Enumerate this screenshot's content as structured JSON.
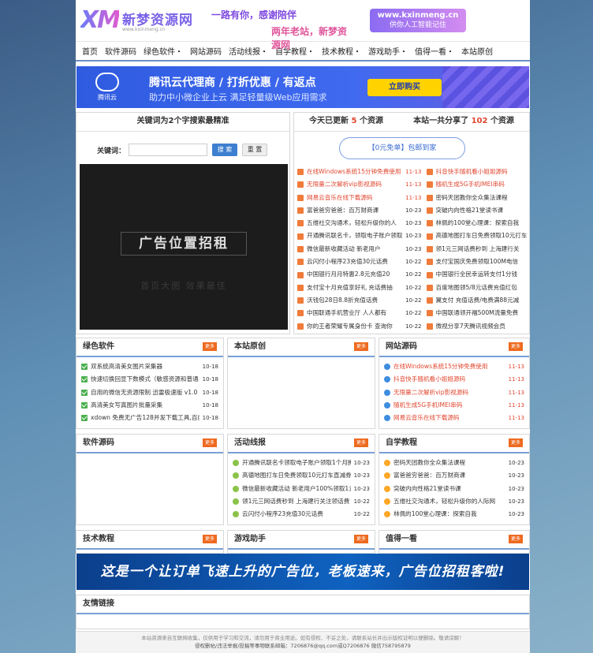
{
  "header": {
    "logo_mark": "XM",
    "logo_cn": "新梦资源网",
    "logo_en": "www.kxinmeng.cn",
    "slogan_line1": "一路有你，感谢陪伴",
    "slogan_line2": "两年老站，新梦资源网",
    "badge_url": "www.kxinmeng.cn",
    "badge_text": "供你人工智能记住"
  },
  "nav": {
    "items": [
      "首页",
      "软件源码",
      "绿色软件・",
      "网站源码",
      "活动线报・",
      "自学教程・",
      "技术教程・",
      "游戏助手・",
      "值得一看・",
      "本站原创"
    ]
  },
  "banner": {
    "brand": "腾讯云",
    "title": "腾讯云代理商 / 打折优惠 / 有返点",
    "subtitle": "助力中小微企业上云 满足轻量级Web应用需求",
    "button": "立即购买"
  },
  "search": {
    "heading": "关键词为2个字搜索最精准",
    "label": "关键词：",
    "button": "搜 索",
    "reset": "重 置",
    "ad_big": "广告位置招租",
    "ad_small": "首页大图 效果最佳"
  },
  "stats": {
    "today_prefix": "今天已更新",
    "today_count": "5",
    "today_suffix": "个资源",
    "total_prefix": "本站一共分享了",
    "total_count": "102",
    "total_suffix": "个资源",
    "free_button": "【0元免单】包邮到家"
  },
  "latest_left": [
    {
      "t": "在线Windows系统15分钟免费使用",
      "d": "11-13",
      "red": true
    },
    {
      "t": "无限量二次解析vip影视源码",
      "d": "11-13",
      "red": true
    },
    {
      "t": "网易云音乐在线下载源码",
      "d": "11-13",
      "red": true
    },
    {
      "t": "富爸爸穷爸爸：百万财商课",
      "d": "10-23",
      "red": false
    },
    {
      "t": "五维社交沟通术，轻松升级你的人",
      "d": "10-23",
      "red": false
    },
    {
      "t": "开通腾讯联名卡，领取电子账户领取",
      "d": "10-23",
      "red": false
    },
    {
      "t": "微信最新收藏活动 新老用户",
      "d": "10-23",
      "red": false
    },
    {
      "t": "云闪付小程序23充值30元话费",
      "d": "10-22",
      "red": false
    },
    {
      "t": "中国银行月月特惠2.8元充值20",
      "d": "10-22",
      "red": false
    },
    {
      "t": "支付宝十月充值享好礼 充话费抽",
      "d": "10-22",
      "red": false
    },
    {
      "t": "沃钱包28日8.8折充值话费",
      "d": "10-22",
      "red": false
    },
    {
      "t": "中国联通手机营业厅 人人都有",
      "d": "10-22",
      "red": false
    },
    {
      "t": "你的王者荣耀专属身份卡 查询你",
      "d": "10-22",
      "red": false
    }
  ],
  "latest_right": [
    {
      "t": "抖音快手随机看小姐姐源码",
      "d": "11-13",
      "red": true
    },
    {
      "t": "随机生成5G手机IMEI串码",
      "d": "11-13",
      "red": true
    },
    {
      "t": "密码天团教你全众集法课程",
      "d": "10-23",
      "red": false
    },
    {
      "t": "突破内向性格21堂读书课",
      "d": "10-23",
      "red": false
    },
    {
      "t": "林佩的100堂心理课：探索自我",
      "d": "10-23",
      "red": false
    },
    {
      "t": "高德地图打车日免费领取10元打车",
      "d": "10-23",
      "red": false
    },
    {
      "t": "领1元三网话费秒到 上海建行关",
      "d": "10-22",
      "red": false
    },
    {
      "t": "支付宝国庆免费领取100M电信",
      "d": "10-22",
      "red": false
    },
    {
      "t": "中国银行全民幸运转支付1分钱",
      "d": "10-22",
      "red": false
    },
    {
      "t": "百度地图领5/8元话费充值红包",
      "d": "10-22",
      "red": false
    },
    {
      "t": "翼支付 充值话费/电费满88元减",
      "d": "10-22",
      "red": false
    },
    {
      "t": "中国联通领开福500M流量免费",
      "d": "10-22",
      "red": false
    },
    {
      "t": "微视分享7天腾讯视频会员",
      "d": "10-22",
      "red": false
    }
  ],
  "sections": {
    "more": "更多",
    "green_software": {
      "title": "绿色软件",
      "items": [
        {
          "t": "双系统高清美女图片采集器",
          "d": "10-18"
        },
        {
          "t": "快速切换回显下数模式（敏感资源和普通",
          "d": "10-18"
        },
        {
          "t": "自用的微信无资源限制 迅雷极速版 v1.0",
          "d": "10-18"
        },
        {
          "t": "高清美女写真图片批量采集",
          "d": "10-18"
        },
        {
          "t": "xdown 免费无广告128并发下载工具,百度",
          "d": "10-18"
        }
      ]
    },
    "original": {
      "title": "本站原创",
      "items": []
    },
    "site_source": {
      "title": "网站源码",
      "items": [
        {
          "t": "在线Windows系统15分钟免费使用",
          "d": "11-13"
        },
        {
          "t": "抖音快手随机看小姐姐源码",
          "d": "11-13"
        },
        {
          "t": "无限量二次解析vip影视源码",
          "d": "11-13"
        },
        {
          "t": "随机生成5G手机IMEI串码",
          "d": "11-13"
        },
        {
          "t": "网易云音乐在线下载源码",
          "d": "11-13"
        }
      ]
    },
    "software_source": {
      "title": "软件源码",
      "items": []
    },
    "activity": {
      "title": "活动线报",
      "items": [
        {
          "t": "开通腾讯联名卡领取电子账户领取1个月腾讯",
          "d": "10-23"
        },
        {
          "t": "高德地图打车日免费领取10元打车直减券",
          "d": "10-23"
        },
        {
          "t": "微信最新收藏活动 新老用户100%领取1元",
          "d": "10-23"
        },
        {
          "t": "领1元三网话费秒到 上海建行关注领话费",
          "d": "10-22"
        },
        {
          "t": "云闪付小程序23充值30元话费",
          "d": "10-22"
        }
      ]
    },
    "self_study": {
      "title": "自学教程",
      "items": [
        {
          "t": "密码天团教你全众集法课程",
          "d": "10-23"
        },
        {
          "t": "富爸爸穷爸爸：百万财商课",
          "d": "10-23"
        },
        {
          "t": "突破内向性格21堂读书课",
          "d": "10-23"
        },
        {
          "t": "五维社交沟通术，轻松升级你的人际网",
          "d": "10-23"
        },
        {
          "t": "林佩的100堂心理课：探索自我",
          "d": "10-23"
        }
      ]
    },
    "tech": {
      "title": "技术教程"
    },
    "game": {
      "title": "游戏助手"
    },
    "worth": {
      "title": "值得一看"
    }
  },
  "adbar": "这是一个让订单飞速上升的广告位，老板速来，广告位招租客啦!",
  "friend_links": "友情链接",
  "footer": {
    "line1": "本站资源来自互联网收集，仅供用于学习和交流，请勿用于商业用途。如有侵权、不妥之处，请联系站长并出示版权证明以便删除。敬请谅解！",
    "line2": "侵权删帖/违法举报/投稿等事物联系邮箱：7206876@qq.com或Q7206876 微信758795879"
  },
  "colors": {
    "accent": "#7aa0d6",
    "more": "#ee6a1f",
    "red_text": "#e0462f"
  }
}
